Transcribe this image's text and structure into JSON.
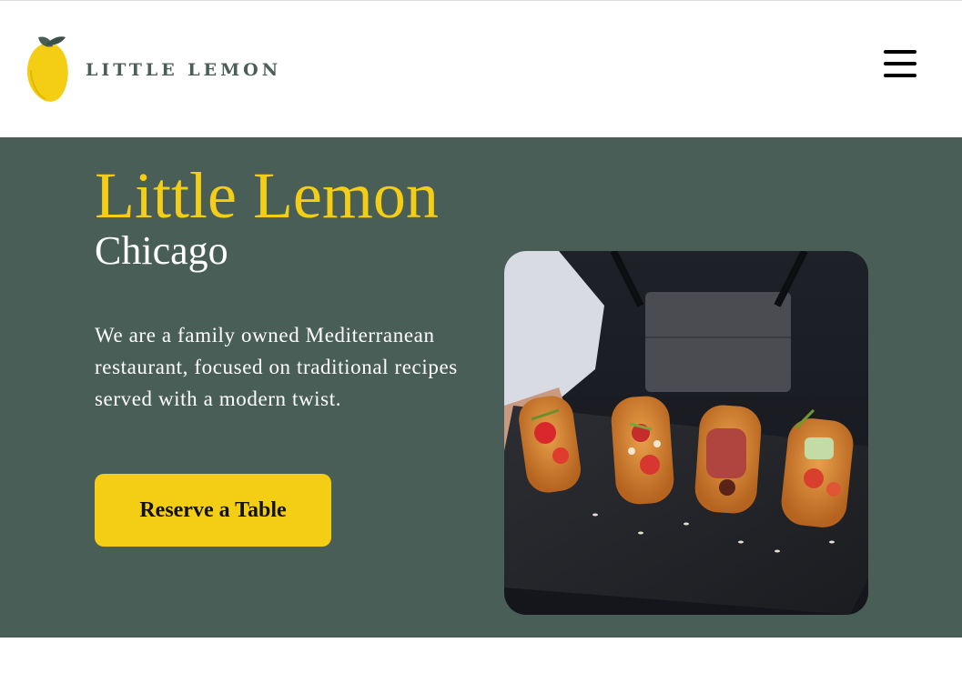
{
  "header": {
    "logo_text": "LITTLE LEMON",
    "logo_icon": "lemon-icon",
    "menu_icon": "hamburger-menu-icon"
  },
  "hero": {
    "title": "Little Lemon",
    "subtitle": "Chicago",
    "description": "We are a family owned Mediterranean restaurant, focused on traditional recipes served with a modern twist.",
    "cta_label": "Reserve a Table",
    "image_subject": "bruschetta-on-slate-photo"
  },
  "colors": {
    "primary_green": "#495e57",
    "primary_yellow": "#f4ce14",
    "text_light": "#ffffff",
    "logo_text": "#495e57"
  }
}
